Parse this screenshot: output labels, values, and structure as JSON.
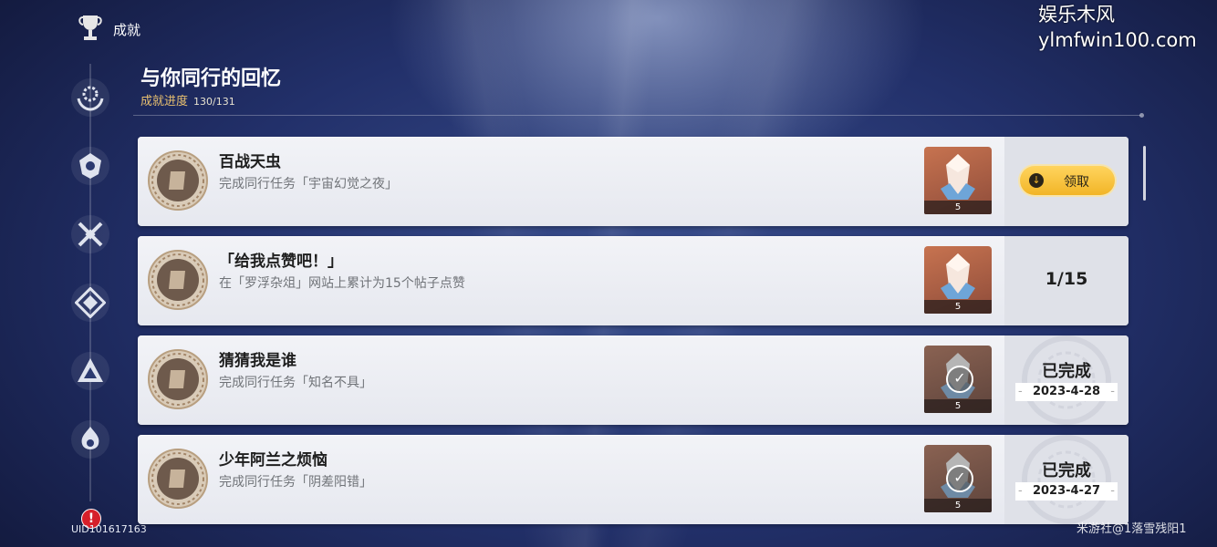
{
  "header": {
    "section_label": "成就",
    "title": "与你同行的回忆",
    "progress_label": "成就进度",
    "progress_value": "130/131"
  },
  "sidebar": {
    "items": [
      {
        "icon": "hands-gear-icon"
      },
      {
        "icon": "helmet-emblem-icon"
      },
      {
        "icon": "crossed-swords-icon"
      },
      {
        "icon": "rhombus-crest-icon"
      },
      {
        "icon": "triangle-crest-icon"
      },
      {
        "icon": "flame-crest-icon"
      }
    ],
    "alert_badge": "!",
    "uid": "UID101617163"
  },
  "achievements": [
    {
      "name": "百战天虫",
      "description": "完成同行任务「宇宙幻觉之夜」",
      "reward_qty": "5",
      "state": "claimable",
      "claim_label": "领取"
    },
    {
      "name": "「给我点赞吧！」",
      "description": "在「罗浮杂俎」网站上累计为15个帖子点赞",
      "reward_qty": "5",
      "state": "in_progress",
      "progress": "1/15"
    },
    {
      "name": "猜猜我是谁",
      "description": "完成同行任务「知名不具」",
      "reward_qty": "5",
      "state": "completed",
      "done_label": "已完成",
      "date": "2023-4-28"
    },
    {
      "name": "少年阿兰之烦恼",
      "description": "完成同行任务「阴差阳错」",
      "reward_qty": "5",
      "state": "completed",
      "done_label": "已完成",
      "date": "2023-4-27"
    }
  ],
  "watermark": {
    "line1": "娱乐木风",
    "line2": "ylmfwin100.com"
  },
  "credit": "米游社@1落雪残阳1",
  "colors": {
    "accent_gold": "#f2b527",
    "progress_gold": "#e8c070"
  }
}
